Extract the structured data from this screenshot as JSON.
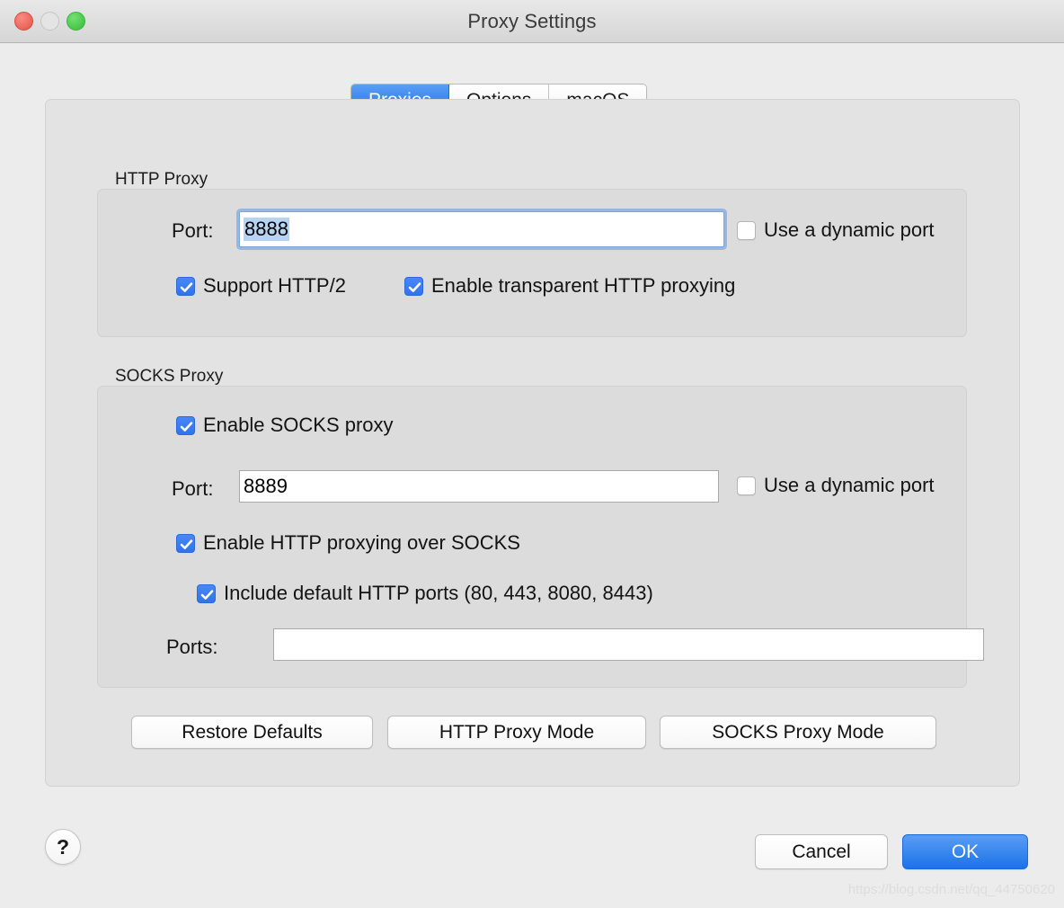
{
  "window": {
    "title": "Proxy Settings",
    "traffic_lights": [
      {
        "name": "close",
        "color": "#ee6a5f"
      },
      {
        "name": "minimize",
        "color": "#e4e4e4"
      },
      {
        "name": "maximize",
        "color": "#4ecb50"
      }
    ]
  },
  "tabs": [
    {
      "label": "Proxies",
      "selected": true
    },
    {
      "label": "Options",
      "selected": false
    },
    {
      "label": "macOS",
      "selected": false
    }
  ],
  "http_proxy": {
    "group_label": "HTTP Proxy",
    "port_label": "Port:",
    "port_value": "8888",
    "port_placeholder": "",
    "dynamic_port": {
      "label": "Use a dynamic port",
      "checked": false
    },
    "support_http2": {
      "label": "Support HTTP/2",
      "checked": true
    },
    "transparent_proxying": {
      "label": "Enable transparent HTTP proxying",
      "checked": true
    }
  },
  "socks_proxy": {
    "group_label": "SOCKS Proxy",
    "enable_socks": {
      "label": "Enable SOCKS proxy",
      "checked": true
    },
    "port_label": "Port:",
    "port_value": "8889",
    "port_placeholder": "",
    "dynamic_port": {
      "label": "Use a dynamic port",
      "checked": false
    },
    "http_over_socks": {
      "label": "Enable HTTP proxying over SOCKS",
      "checked": true
    },
    "include_default_ports": {
      "label": "Include default HTTP ports (80, 443, 8080, 8443)",
      "checked": true
    },
    "ports_label": "Ports:",
    "ports_value": "",
    "ports_placeholder": ""
  },
  "mode_buttons": [
    {
      "label": "Restore Defaults"
    },
    {
      "label": "HTTP Proxy Mode"
    },
    {
      "label": "SOCKS Proxy Mode"
    }
  ],
  "footer": {
    "help_label": "?",
    "cancel_label": "Cancel",
    "ok_label": "OK"
  },
  "watermark": "https://blog.csdn.net/qq_44750620",
  "colors": {
    "accent_blue": "#2f73ee",
    "window_bg": "#ececec",
    "panel_bg": "#e3e3e3",
    "group_bg": "#dcdcdc",
    "selection_blue": "#b6d4f2"
  }
}
